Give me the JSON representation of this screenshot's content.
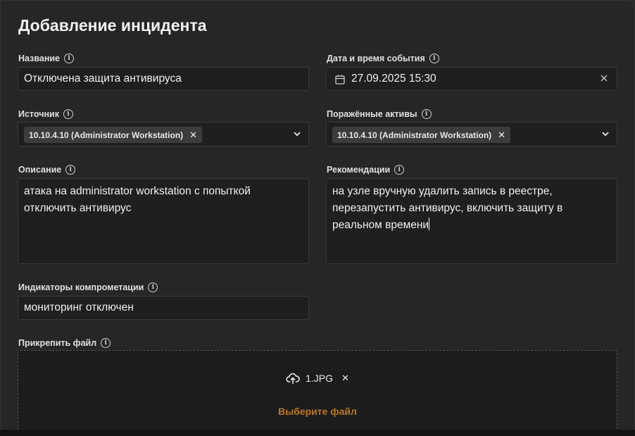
{
  "dialog": {
    "title": "Добавление инцидента"
  },
  "name_field": {
    "label": "Название",
    "value": "Отключена защита антивируса"
  },
  "datetime_field": {
    "label": "Дата и время события",
    "value": "27.09.2025 15:30"
  },
  "source_field": {
    "label": "Источник",
    "tag": "10.10.4.10 (Administrator Workstation)"
  },
  "assets_field": {
    "label": "Поражённые активы",
    "tag": "10.10.4.10 (Administrator Workstation)"
  },
  "description_field": {
    "label": "Описание",
    "value": "атака на administrator workstation с попыткой\nотключить антивирус"
  },
  "recommendations_field": {
    "label": "Рекомендации",
    "value": "на узле вручную удалить запись в реестре,\nперезапустить антивирус, включить защиту в\nреальном времени"
  },
  "ioc_field": {
    "label": "Индикаторы компрометации",
    "value": "мониторинг отключен"
  },
  "attach_field": {
    "label": "Прикрепить файл",
    "file_name": "1.JPG",
    "choose_label": "Выберите файл"
  },
  "colors": {
    "accent": "#b87922",
    "background": "#262626",
    "field_bg": "#1f1f1f"
  },
  "icons": [
    "info-icon",
    "calendar-icon",
    "clear-icon",
    "chevron-down-icon",
    "remove-tag-icon",
    "upload-cloud-icon"
  ]
}
